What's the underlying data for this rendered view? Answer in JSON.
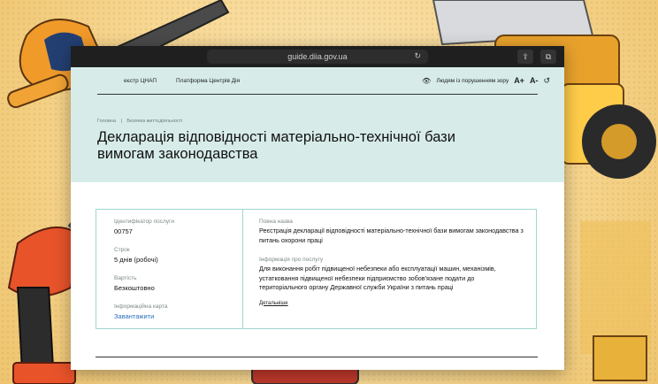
{
  "browser": {
    "url": "guide.diia.gov.ua"
  },
  "nav": {
    "items": [
      "еєстр ЦНАП",
      "Платформа Центрів Дія"
    ],
    "vision_mode": "Людям із порушенням зору",
    "font_increase": "A+",
    "font_decrease": "A-",
    "reset_icon": "reset-icon"
  },
  "breadcrumb": {
    "home": "Головна",
    "separator": "|",
    "section": "Безпека життєдіяльності"
  },
  "page": {
    "title": "Декларація відповідності матеріально-технічної бази вимогам законодавства"
  },
  "card": {
    "left": {
      "id_label": "Ідентифікатор послуги",
      "id_value": "00757",
      "term_label": "Строк",
      "term_value": "5 днів (робочі)",
      "cost_label": "Вартість",
      "cost_value": "Безкоштовно",
      "info_card_label": "Інформаційна карта",
      "download_label": "Завантажити"
    },
    "right": {
      "full_name_label": "Повна назва",
      "full_name_value": "Реєстрація декларації відповідності матеріально-технічної бази вимогам законодавства з питань охорони праці",
      "service_info_label": "Інформація про послугу",
      "service_info_value": "Для виконання робіт підвищеної небезпеки або експлуатації машин, механізмів, устатковання підвищеної небезпеки підприємство зобов'язане подати до територіального органу Державної служби України з питань праці",
      "details_label": "Детальніше"
    }
  },
  "colors": {
    "hero_bg": "#d7ece9",
    "card_border": "#9fd6cf",
    "link": "#2a6ebb",
    "background": "#f6d58f"
  }
}
